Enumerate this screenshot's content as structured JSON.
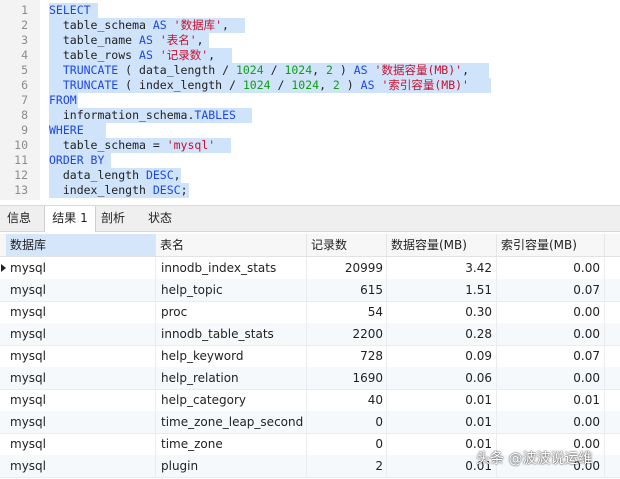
{
  "editor": {
    "lines": [
      {
        "n": "1",
        "tokens": [
          {
            "t": "SELECT",
            "c": "kw"
          }
        ]
      },
      {
        "n": "2",
        "tokens": [
          {
            "t": "  table_schema ",
            "c": "id"
          },
          {
            "t": "AS",
            "c": "kw"
          },
          {
            "t": " ",
            "c": "id"
          },
          {
            "t": "'数据库'",
            "c": "str"
          },
          {
            "t": ",",
            "c": "id"
          }
        ]
      },
      {
        "n": "3",
        "tokens": [
          {
            "t": "  table_name ",
            "c": "id"
          },
          {
            "t": "AS",
            "c": "kw"
          },
          {
            "t": " ",
            "c": "id"
          },
          {
            "t": "'表名'",
            "c": "str"
          },
          {
            "t": ",",
            "c": "id"
          }
        ]
      },
      {
        "n": "4",
        "tokens": [
          {
            "t": "  table_rows ",
            "c": "id"
          },
          {
            "t": "AS",
            "c": "kw"
          },
          {
            "t": " ",
            "c": "id"
          },
          {
            "t": "'记录数'",
            "c": "str"
          },
          {
            "t": ",",
            "c": "id"
          }
        ]
      },
      {
        "n": "5",
        "tokens": [
          {
            "t": "  TRUNCATE",
            "c": "fn"
          },
          {
            "t": " ( data_length / ",
            "c": "id"
          },
          {
            "t": "1024",
            "c": "num"
          },
          {
            "t": " / ",
            "c": "id"
          },
          {
            "t": "1024",
            "c": "num"
          },
          {
            "t": ", ",
            "c": "id"
          },
          {
            "t": "2",
            "c": "num"
          },
          {
            "t": " ) ",
            "c": "id"
          },
          {
            "t": "AS",
            "c": "kw"
          },
          {
            "t": " ",
            "c": "id"
          },
          {
            "t": "'数据容量(MB)'",
            "c": "str"
          },
          {
            "t": ",",
            "c": "id"
          }
        ]
      },
      {
        "n": "6",
        "tokens": [
          {
            "t": "  TRUNCATE",
            "c": "fn"
          },
          {
            "t": " ( index_length / ",
            "c": "id"
          },
          {
            "t": "1024",
            "c": "num"
          },
          {
            "t": " / ",
            "c": "id"
          },
          {
            "t": "1024",
            "c": "num"
          },
          {
            "t": ", ",
            "c": "id"
          },
          {
            "t": "2",
            "c": "num"
          },
          {
            "t": " ) ",
            "c": "id"
          },
          {
            "t": "AS",
            "c": "kw"
          },
          {
            "t": " ",
            "c": "id"
          },
          {
            "t": "'索引容量(MB)'",
            "c": "str"
          }
        ]
      },
      {
        "n": "7",
        "tokens": [
          {
            "t": "FROM",
            "c": "kw"
          }
        ]
      },
      {
        "n": "8",
        "tokens": [
          {
            "t": "  information_schema.",
            "c": "id"
          },
          {
            "t": "TABLES",
            "c": "kw"
          }
        ]
      },
      {
        "n": "9",
        "tokens": [
          {
            "t": "WHERE",
            "c": "kw"
          }
        ]
      },
      {
        "n": "10",
        "tokens": [
          {
            "t": "  table_schema = ",
            "c": "id"
          },
          {
            "t": "'mysql'",
            "c": "str"
          }
        ]
      },
      {
        "n": "11",
        "tokens": [
          {
            "t": "ORDER BY",
            "c": "kw"
          }
        ]
      },
      {
        "n": "12",
        "tokens": [
          {
            "t": "  data_length ",
            "c": "id"
          },
          {
            "t": "DESC",
            "c": "kw"
          },
          {
            "t": ",",
            "c": "id"
          }
        ]
      },
      {
        "n": "13",
        "tokens": [
          {
            "t": "  index_length ",
            "c": "id"
          },
          {
            "t": "DESC",
            "c": "kw"
          },
          {
            "t": ";",
            "c": "id"
          }
        ]
      }
    ]
  },
  "tabs": [
    {
      "label": "信息",
      "active": false
    },
    {
      "label": "结果 1",
      "active": true
    },
    {
      "label": "剖析",
      "active": false
    },
    {
      "label": "状态",
      "active": false
    }
  ],
  "grid": {
    "columns": [
      "数据库",
      "表名",
      "记录数",
      "数据容量(MB)",
      "索引容量(MB)"
    ],
    "rows": [
      [
        "mysql",
        "innodb_index_stats",
        "20999",
        "3.42",
        "0.00"
      ],
      [
        "mysql",
        "help_topic",
        "615",
        "1.51",
        "0.07"
      ],
      [
        "mysql",
        "proc",
        "54",
        "0.30",
        "0.00"
      ],
      [
        "mysql",
        "innodb_table_stats",
        "2200",
        "0.28",
        "0.00"
      ],
      [
        "mysql",
        "help_keyword",
        "728",
        "0.09",
        "0.07"
      ],
      [
        "mysql",
        "help_relation",
        "1690",
        "0.06",
        "0.00"
      ],
      [
        "mysql",
        "help_category",
        "40",
        "0.01",
        "0.01"
      ],
      [
        "mysql",
        "time_zone_leap_second",
        "0",
        "0.01",
        "0.00"
      ],
      [
        "mysql",
        "time_zone",
        "0",
        "0.01",
        "0.00"
      ],
      [
        "mysql",
        "plugin",
        "2",
        "0.01",
        "0.00"
      ]
    ]
  },
  "watermark": "头条 @波波说运维"
}
